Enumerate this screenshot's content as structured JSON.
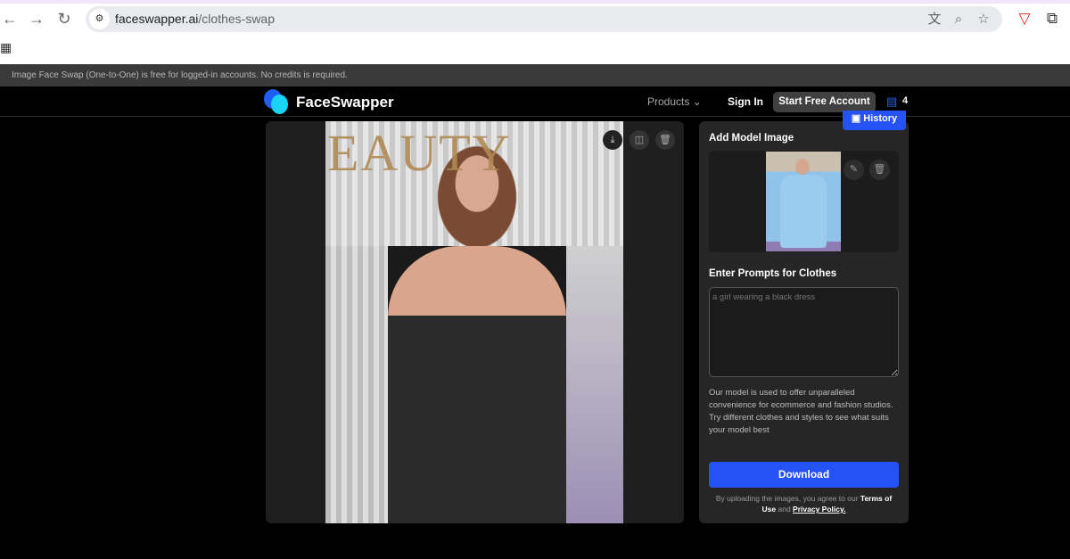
{
  "browser": {
    "url_domain": "faceswapper.ai",
    "url_path": "/clothes-swap",
    "icons": [
      "back-icon",
      "forward-icon",
      "reload-icon",
      "site-settings-icon",
      "translate-icon",
      "zoom-icon",
      "bookmark-star-icon",
      "shield-extension-icon",
      "extensions-puzzle-icon",
      "apps-grid-icon"
    ]
  },
  "notice": "Image Face Swap (One-to-One) is free for logged-in accounts. No credits is required.",
  "header": {
    "brand": "FaceSwapper",
    "products": "Products",
    "sign_in": "Sign In",
    "start_free": "Start Free Account",
    "credits": "4",
    "history": "History"
  },
  "result": {
    "photo_title": "EAUTY",
    "actions": [
      "download",
      "compare",
      "delete"
    ]
  },
  "sidebar": {
    "model_label": "Add Model Image",
    "prompt_label": "Enter Prompts for Clothes",
    "prompt_placeholder": "a girl wearing a black dress",
    "description": "Our model is used to offer unparalleled convenience for ecommerce and fashion studios. Try different clothes and styles to see what suits your model best",
    "download": "Download",
    "terms_prefix": "By uploading the images, you agree to our ",
    "terms_link": "Terms of Use",
    "terms_and": " and ",
    "privacy_link": "Privacy Policy."
  },
  "colors": {
    "accent": "#2452f4",
    "panel": "#262626",
    "logo_blue": "#1d5ef5",
    "logo_cyan": "#19d3f3"
  }
}
